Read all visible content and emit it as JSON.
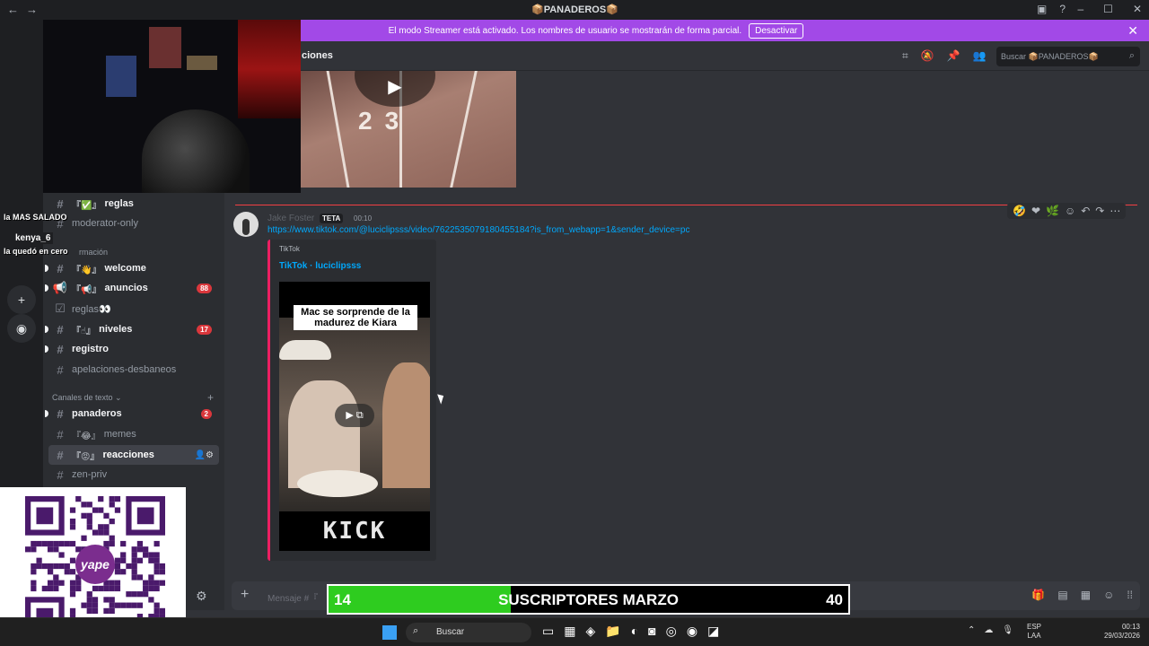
{
  "window": {
    "title": "📦PANADEROS📦"
  },
  "banner": {
    "text": "El modo Streamer está activado. Los nombres de usuario se mostrarán de forma parcial.",
    "button": "Desactivar"
  },
  "header": {
    "channel_name": "ciones",
    "search_placeholder": "Buscar 📦PANADEROS📦"
  },
  "sidebar": {
    "channels_top": [
      {
        "prefix": "『✅』",
        "name": "reglas"
      },
      {
        "prefix": "",
        "name": "moderator-only"
      },
      {
        "prefix": "『👋』",
        "name": "welcome"
      },
      {
        "prefix": "『📢』",
        "name": "anuncios",
        "badge": "88"
      },
      {
        "prefix": "",
        "name": "reglas👀"
      },
      {
        "prefix": "『☝』",
        "name": "niveles",
        "badge": "17"
      },
      {
        "prefix": "",
        "name": "registro"
      },
      {
        "prefix": "",
        "name": "apelaciones-desbaneos"
      }
    ],
    "category_info": "rmación",
    "category_text": "Canales de texto",
    "channels_text": [
      {
        "prefix": "",
        "name": "panaderos",
        "badge": "2"
      },
      {
        "prefix": "『😂』",
        "name": "memes"
      },
      {
        "prefix": "『😡』",
        "name": "reacciones"
      },
      {
        "prefix": "",
        "name": "zen-priv"
      }
    ]
  },
  "message": {
    "author": "Jake Foster",
    "tag": "TETA",
    "time": "00:10",
    "link": "https://www.tiktok.com/@luciclipsss/video/7622535079180455184?is_from_webapp=1&sender_device=pc",
    "embed": {
      "provider": "TikTok",
      "title": "TikTok · luciclipsss",
      "caption": "Mac se sorprende de la madurez de Kiara",
      "watermark": "KICK"
    }
  },
  "top_video": {
    "numbers": "23"
  },
  "input": {
    "placeholder": "Mensaje #『"
  },
  "stream_overlay": {
    "chat_lines": [
      "la MAS SALADO",
      "la quedó en cero"
    ],
    "chat_user": "kenya_6",
    "sub_goal": {
      "label": "SUSCRIPTORES MARZO",
      "current": "14",
      "goal": "40",
      "progress": 0.35
    },
    "qr_brand": "yape"
  },
  "taskbar": {
    "search": "Buscar",
    "lang_top": "ESP",
    "lang_bottom": "LAA",
    "time": "00:13",
    "date": "29/03/2026"
  },
  "colors": {
    "banner": "#a249e7",
    "accent_link": "#00a8fc",
    "unread_badge": "#da373c",
    "embed_border": "#ec1f62",
    "sub_fill": "#2ecc1f"
  }
}
